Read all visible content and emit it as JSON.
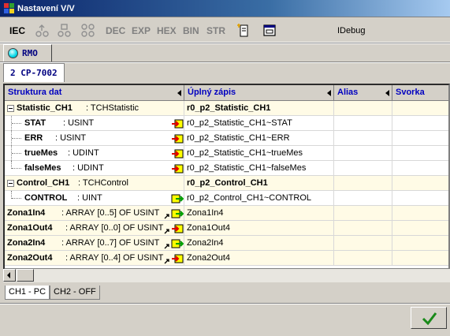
{
  "window": {
    "title": "Nastavení V/V"
  },
  "toolbar": {
    "iec": "IEC",
    "dec": "DEC",
    "exp": "EXP",
    "hex": "HEX",
    "bin": "BIN",
    "str": "STR",
    "debug": "IDebug",
    "icons": [
      "io-cfg-icon-1",
      "io-cfg-icon-2",
      "io-cfg-icon-3",
      "insert-icon",
      "window-icon"
    ]
  },
  "tabs": {
    "station": "RMO",
    "module": "2 CP-7002"
  },
  "table": {
    "columns": [
      "Struktura dat",
      "Úplný zápis",
      "Alias",
      "Svorka"
    ],
    "rows": [
      {
        "name": "Statistic_CH1",
        "type": ": TCHStatistic",
        "full": "r0_p2_Statistic_CH1"
      },
      {
        "name": "STAT",
        "type": ": USINT",
        "full": "r0_p2_Statistic_CH1~STAT"
      },
      {
        "name": "ERR",
        "type": ": USINT",
        "full": "r0_p2_Statistic_CH1~ERR"
      },
      {
        "name": "trueMes",
        "type": ": UDINT",
        "full": "r0_p2_Statistic_CH1~trueMes"
      },
      {
        "name": "falseMes",
        "type": ": UDINT",
        "full": "r0_p2_Statistic_CH1~falseMes"
      },
      {
        "name": "Control_CH1",
        "type": ": TCHControl",
        "full": "r0_p2_Control_CH1"
      },
      {
        "name": "CONTROL",
        "type": ": UINT",
        "full": "r0_p2_Control_CH1~CONTROL"
      },
      {
        "name": "Zona1In4",
        "type": ": ARRAY [0..5] OF USINT",
        "full": "Zona1In4"
      },
      {
        "name": "Zona1Out4",
        "type": ": ARRAY [0..0] OF USINT",
        "full": "Zona1Out4"
      },
      {
        "name": "Zona2In4",
        "type": ": ARRAY [0..7] OF USINT",
        "full": "Zona2In4"
      },
      {
        "name": "Zona2Out4",
        "type": ": ARRAY [0..4] OF USINT",
        "full": "Zona2Out4"
      }
    ]
  },
  "bottom_tabs": {
    "active": "CH1 - PC",
    "inactive": "CH2 - OFF"
  },
  "colors": {
    "header_text": "#0000c0",
    "row_highlight": "#fffbe6",
    "ok_green": "#1a8a1a"
  }
}
